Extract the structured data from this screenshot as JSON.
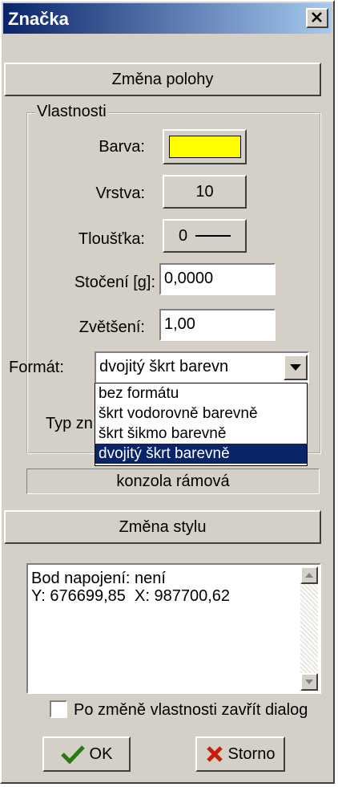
{
  "window": {
    "title": "Značka"
  },
  "buttons": {
    "position_change": "Změna polohy",
    "style_change": "Změna stylu",
    "ok": "OK",
    "cancel": "Storno"
  },
  "group": {
    "label": "Vlastnosti",
    "color_label": "Barva:",
    "color_value": "#ffff00",
    "layer_label": "Vrstva:",
    "layer_value": "10",
    "thickness_label": "Tloušťka:",
    "thickness_value": "0",
    "rotation_label": "Stočení [g]:",
    "rotation_value": "0,0000",
    "scale_label": "Zvětšení:",
    "scale_value": "1,00",
    "format_label": "Formát:",
    "format_selected": "dvojitý škrt barevn",
    "format_options": [
      "bez formátu",
      "škrt vodorovně barevně",
      "škrt šikmo barevně",
      "dvojitý škrt barevně"
    ],
    "type_label": "Typ zn"
  },
  "style_name": "konzola rámová",
  "info": {
    "line1": "Bod napojení: není",
    "line2": "Y: 676699,85  X: 987700,62"
  },
  "close_after_change_label": "Po změně vlastnosti zavřít dialog"
}
